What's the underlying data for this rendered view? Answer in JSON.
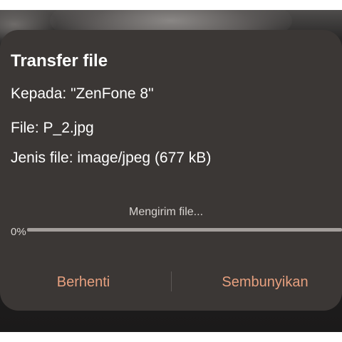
{
  "dialog": {
    "title": "Transfer file",
    "to_line": "Kepada: \"ZenFone 8\"",
    "file_line": "File: P_2.jpg",
    "type_line": "Jenis file: image/jpeg (677 kB)",
    "status": "Mengirim file...",
    "progress_label": "0%",
    "progress_value": 0,
    "stop_label": "Berhenti",
    "hide_label": "Sembunyikan"
  },
  "colors": {
    "dialog_background": "#3b3735",
    "accent": "#e7a07f",
    "text_primary": "#ffffff",
    "text_secondary": "#d8d4d1",
    "progress_track": "#a39e9b"
  }
}
